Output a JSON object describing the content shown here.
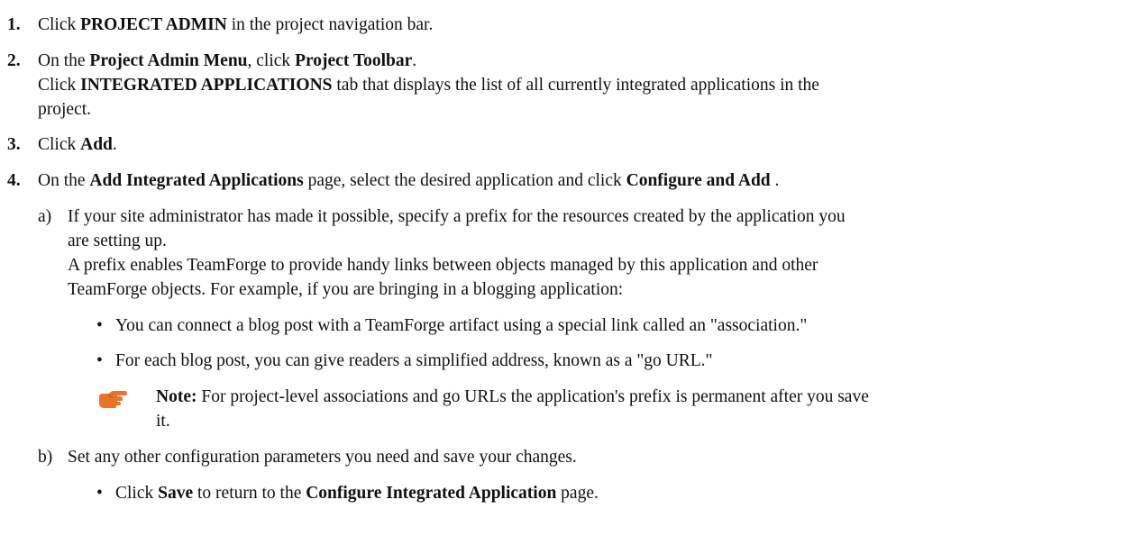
{
  "steps": [
    {
      "number": "1.",
      "pre": "Click ",
      "b1": "PROJECT ADMIN",
      "post": " in the project navigation bar."
    },
    {
      "number": "2.",
      "line1_pre": "On the ",
      "line1_b1": "Project Admin Menu",
      "line1_mid": ", click ",
      "line1_b2": "Project Toolbar",
      "line1_post": ".",
      "line2_pre": "Click ",
      "line2_b1": "INTEGRATED APPLICATIONS",
      "line2_post": " tab that displays the list of all currently integrated applications in the",
      "line3": "project."
    },
    {
      "number": "3.",
      "pre": "Click ",
      "b1": "Add",
      "post": "."
    },
    {
      "number": "4.",
      "pre": "On the ",
      "b1": "Add Integrated Applications",
      "mid": " page, select the desired application and click ",
      "b2": "Configure and Add",
      "post": " ."
    }
  ],
  "sub_a": {
    "letter": "a)",
    "line1": "If your site administrator has made it possible, specify a prefix for the resources created by the application you",
    "line2": "are setting up.",
    "line3": "A prefix enables TeamForge to provide handy links between objects managed by this application and other",
    "line4": "TeamForge objects. For example, if you are bringing in a blogging application:",
    "bullets": [
      "You can connect a blog post with a TeamForge artifact using a special link called an \"association.\"",
      "For each blog post, you can give readers a simplified address, known as a \"go URL.\""
    ],
    "note_label": "Note:",
    "note_line1": " For project-level associations and go URLs the application's prefix is permanent after you save",
    "note_line2": "it."
  },
  "sub_b": {
    "letter": "b)",
    "line1": "Set any other configuration parameters you need and save your changes.",
    "bullet_pre": "Click ",
    "bullet_b1": "Save",
    "bullet_mid": " to return to the ",
    "bullet_b2": "Configure Integrated Application",
    "bullet_post": " page."
  },
  "bullet_glyph": "•",
  "note_icon_name": "pointing-hand-icon",
  "colors": {
    "text": "#111111",
    "note_icon": "#e8732a"
  }
}
